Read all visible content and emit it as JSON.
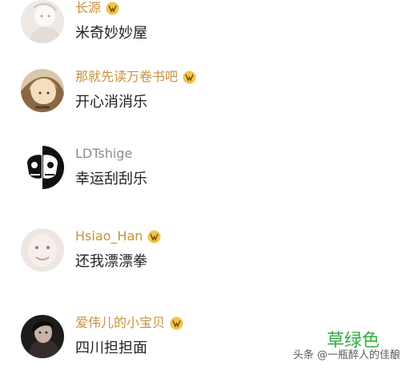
{
  "comments": [
    {
      "username": "长源",
      "text": "米奇妙妙屋",
      "avatar": "avatar-light-sketch-icon",
      "badge": "vip-badge-icon"
    },
    {
      "username": "那就先读万卷书吧",
      "text": "开心消消乐",
      "avatar": "avatar-blonde-girl-icon",
      "badge": "vip-badge-icon"
    },
    {
      "username": "LDTshige",
      "text": "幸运刮刮乐",
      "avatar": "avatar-skull-split-icon",
      "badge": ""
    },
    {
      "username": "Hsiao_Han",
      "text": "还我漂漂拳",
      "avatar": "avatar-blurred-face-icon",
      "badge": "vip-badge-icon"
    },
    {
      "username": "爱伟儿的小宝贝",
      "text": "四川担担面",
      "avatar": "avatar-dark-portrait-icon",
      "badge": "vip-badge-icon"
    }
  ],
  "watermark": {
    "green_text": "草绿色",
    "source_text": "头条 @一瓶醉人的佳酿"
  },
  "colors": {
    "vip_username": "#c7913d",
    "plain_username": "#8d8d8d",
    "comment_text": "#222222",
    "watermark_green": "#2fad42"
  }
}
